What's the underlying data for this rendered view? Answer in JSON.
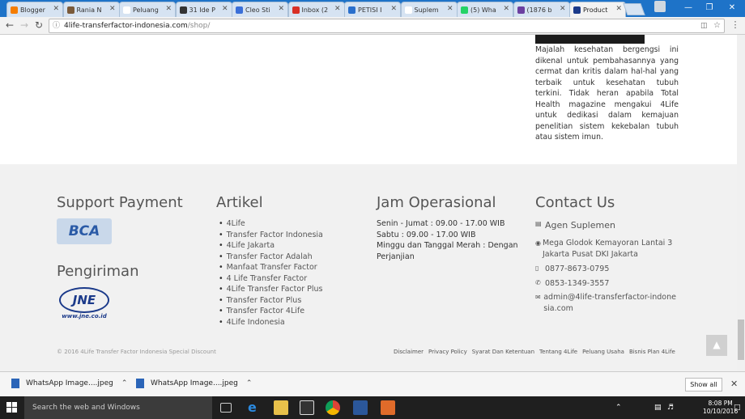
{
  "browser": {
    "tabs": [
      {
        "label": "Blogger",
        "color": "#f57d00"
      },
      {
        "label": "Rania N",
        "color": "#7a5a3a"
      },
      {
        "label": "Peluang",
        "color": "#ffffff"
      },
      {
        "label": "31 Ide P",
        "color": "#333333"
      },
      {
        "label": "Cleo Sti",
        "color": "#3a6fd8"
      },
      {
        "label": "Inbox (2",
        "color": "#d93025"
      },
      {
        "label": "PETISI I",
        "color": "#2a6fcc"
      },
      {
        "label": "Suplem",
        "color": "#ffffff"
      },
      {
        "label": "(5) Wha",
        "color": "#25d366"
      },
      {
        "label": "(1876 b",
        "color": "#6b3fa0"
      },
      {
        "label": "Product",
        "color": "#1b3a8a"
      }
    ],
    "url_domain": "4life-transferfactor-indonesia.com",
    "url_path": "/shop/"
  },
  "article": {
    "text": "Majalah kesehatan bergengsi ini dikenal untuk pembahasannya yang cermat dan kritis dalam hal-hal yang terbaik untuk kesehatan tubuh terkini. Tidak heran apabila Total Health magazine mengakui 4Life untuk dedikasi dalam kemajuan penelitian sistem kekebalan tubuh atau sistem imun."
  },
  "footer": {
    "support_payment_title": "Support Payment",
    "bca_logo": "BCA",
    "pengiriman_title": "Pengiriman",
    "jne_logo": "JNE",
    "jne_url": "www.jne.co.id",
    "artikel_title": "Artikel",
    "artikel_items": [
      "4Life",
      "Transfer Factor Indonesia",
      "4Life Jakarta",
      "Transfer Factor Adalah",
      "Manfaat Transfer Factor",
      "4 Life Transfer Factor",
      "4Life Transfer Factor Plus",
      "Transfer Factor Plus",
      "Transfer Factor 4Life",
      "4Life Indonesia"
    ],
    "jam_title": "Jam Operasional",
    "jam_line1": "Senin - Jumat : 09.00 - 17.00 WIB",
    "jam_line2": "Sabtu : 09.00 - 17.00 WIB",
    "jam_line3": "Minggu dan Tanggal Merah : Dengan Perjanjian",
    "contact_title": "Contact Us",
    "contact_name": "Agen Suplemen",
    "contact_address": "Mega Glodok Kemayoran Lantai 3 Jakarta Pusat DKI Jakarta",
    "contact_phone1": "0877-8673-0795",
    "contact_phone2": "0853-1349-3557",
    "contact_email": "admin@4life-transferfactor-indonesia.com",
    "copyright": "© 2016 4Life Transfer Factor Indonesia Special Discount",
    "links": [
      "Disclaimer",
      "Privacy Policy",
      "Syarat Dan Ketentuan",
      "Tentang 4Life",
      "Peluang Usaha",
      "Bisnis Plan 4Life"
    ]
  },
  "downloads": {
    "items": [
      "WhatsApp Image....jpeg",
      "WhatsApp Image....jpeg"
    ],
    "show_all": "Show all"
  },
  "taskbar": {
    "search_placeholder": "Search the web and Windows",
    "time": "8:08 PM",
    "date": "10/10/2016"
  }
}
